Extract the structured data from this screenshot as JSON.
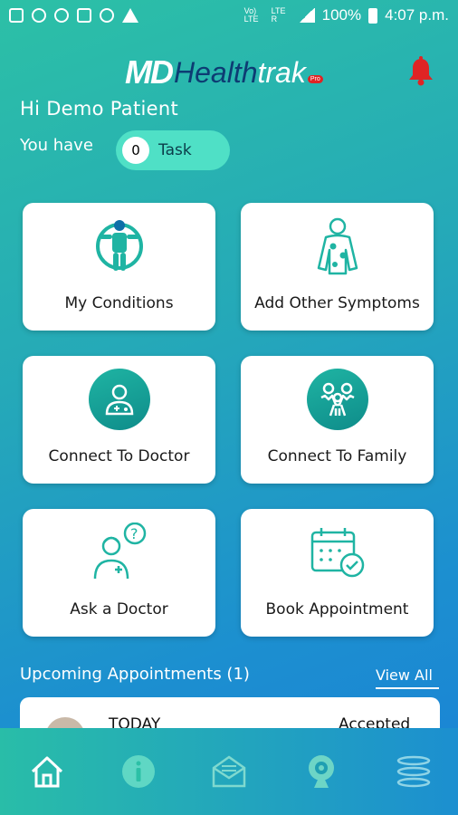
{
  "status_bar": {
    "network": "Vo) LTE",
    "lte": "LTE R",
    "battery": "100%",
    "time": "4:07 p.m."
  },
  "header": {
    "logo_md": "MD",
    "logo_health": "Health",
    "logo_trak": "trak",
    "logo_pro": "Pro"
  },
  "greeting": "Hi Demo Patient",
  "tasks": {
    "prefix": "You have",
    "count": "0",
    "label": "Task"
  },
  "cards": [
    {
      "label": "My Conditions",
      "icon": "body-scan-icon"
    },
    {
      "label": "Add Other Symptoms",
      "icon": "body-symptoms-icon"
    },
    {
      "label": "Connect To Doctor",
      "icon": "doctor-icon"
    },
    {
      "label": "Connect To Family",
      "icon": "family-icon"
    },
    {
      "label": "Ask a Doctor",
      "icon": "doctor-question-icon"
    },
    {
      "label": "Book Appointment",
      "icon": "calendar-check-icon"
    }
  ],
  "appointments": {
    "title": "Upcoming Appointments  (1)",
    "view_all": "View All",
    "items": [
      {
        "date": "TODAY",
        "status": "Accepted"
      }
    ]
  },
  "bottom_nav": [
    "home-icon",
    "info-icon",
    "mail-icon",
    "webcam-icon",
    "menu-icon"
  ],
  "colors": {
    "accent": "#4fe0c6",
    "icon_teal": "#1fb4a3",
    "logo_navy": "#0d3c73",
    "bell_red": "#e02424"
  }
}
